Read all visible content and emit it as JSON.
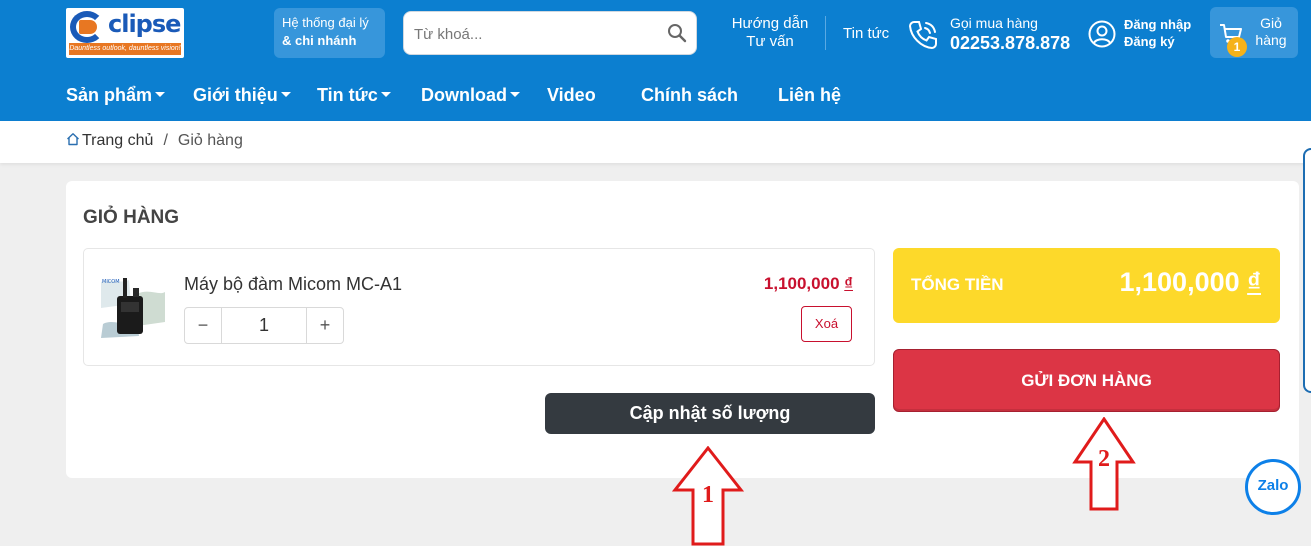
{
  "header": {
    "logo_text": "clipse",
    "logo_slogan": "Dauntless outlook, dauntless vision!",
    "dealer_line1": "Hệ thống đại lý",
    "dealer_line2": "& chi nhánh",
    "search_placeholder": "Từ khoá...",
    "guide_line1": "Hướng dẫn",
    "guide_line2": "Tư vấn",
    "news": "Tin tức",
    "hotline_label": "Gọi mua hàng",
    "hotline_number": "02253.878.878",
    "login": "Đăng nhập",
    "register": "Đăng ký",
    "cart_line1": "Giỏ",
    "cart_line2": "hàng",
    "cart_count": "1"
  },
  "nav": [
    {
      "label": "Sản phẩm",
      "dropdown": true
    },
    {
      "label": "Giới thiệu",
      "dropdown": true
    },
    {
      "label": "Tin tức",
      "dropdown": true
    },
    {
      "label": "Download",
      "dropdown": true
    },
    {
      "label": "Video",
      "dropdown": false
    },
    {
      "label": "Chính sách",
      "dropdown": false
    },
    {
      "label": "Liên hệ",
      "dropdown": false
    }
  ],
  "breadcrumb": {
    "home": "Trang chủ",
    "separator": "/",
    "current": "Giỏ hàng"
  },
  "cart": {
    "title": "GIỎ HÀNG",
    "item": {
      "name": "Máy bộ đàm Micom MC-A1",
      "price": "1,100,000",
      "currency": "₫",
      "quantity": "1",
      "minus": "−",
      "plus": "+",
      "delete_label": "Xoá"
    },
    "update_label": "Cập nhật số lượng",
    "total_label": "TỔNG TIỀN",
    "total_value": "1,100,000",
    "total_currency": "₫",
    "submit_label": "GỬI ĐƠN HÀNG"
  },
  "annotations": {
    "arrow1": "1",
    "arrow2": "2"
  },
  "widgets": {
    "zalo": "Zalo"
  },
  "colors": {
    "header_bg": "#0c7fd0",
    "total_bg": "#fdd92a",
    "submit_bg": "#dc3545",
    "update_bg": "#343a40",
    "price_red": "#c8102e",
    "annotation_red": "#e01b1b"
  }
}
